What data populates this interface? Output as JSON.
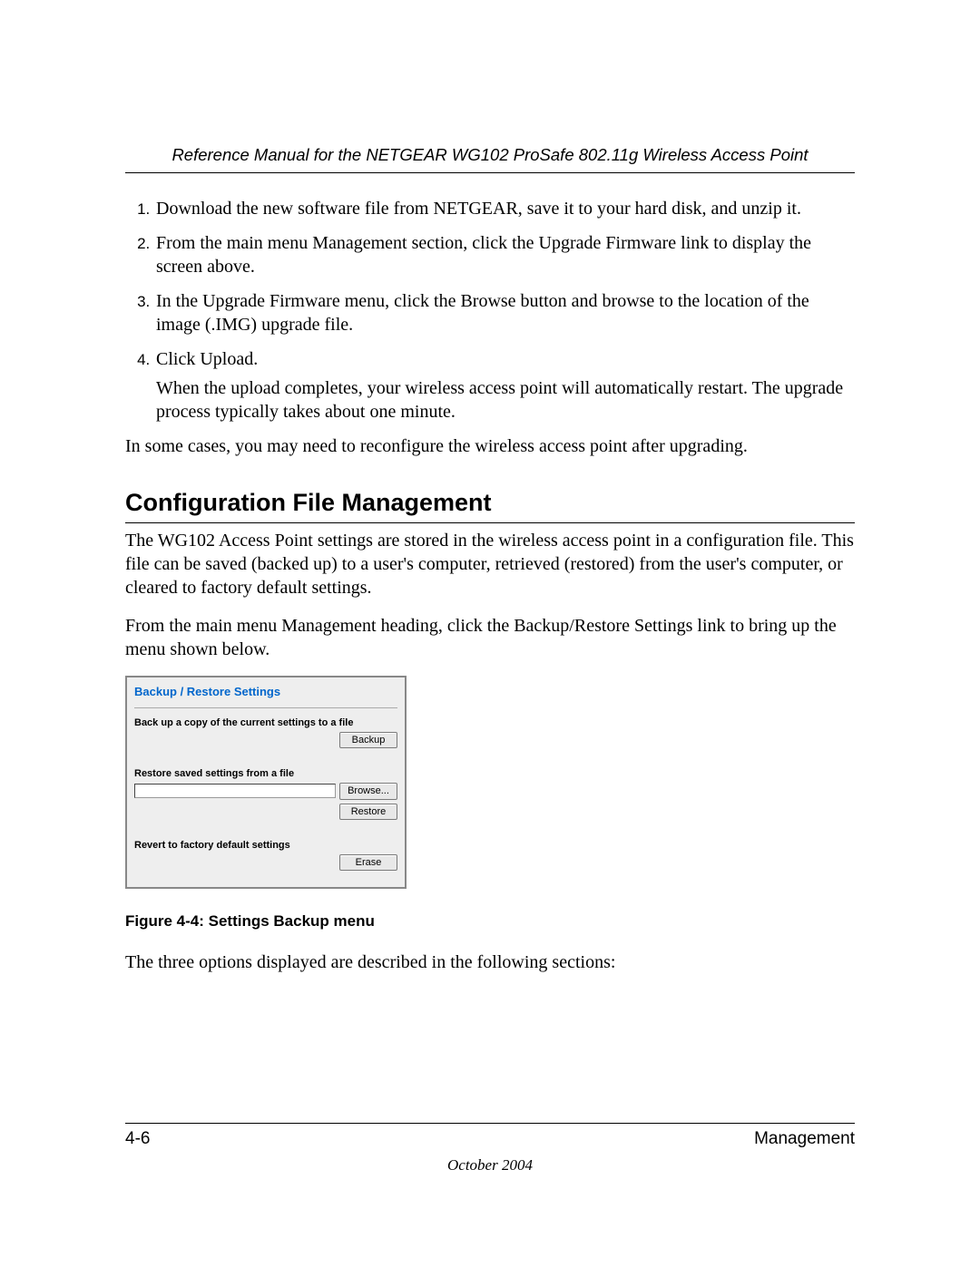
{
  "header": {
    "running_title": "Reference Manual for the NETGEAR WG102 ProSafe 802.11g Wireless Access Point"
  },
  "steps": {
    "s1": "Download the new software file from NETGEAR, save it to your hard disk, and unzip it.",
    "s2": "From the main menu Management section, click the Upgrade Firmware link to display the screen above.",
    "s3": "In the Upgrade Firmware menu, click the Browse button and browse to the location of the image (.IMG) upgrade file.",
    "s4": "Click Upload.",
    "s4b": "When the upload completes, your wireless access point will automatically restart. The upgrade process typically takes about one minute."
  },
  "para_after_steps": "In some cases, you may need to reconfigure the wireless access point after upgrading.",
  "section_heading": "Configuration File Management",
  "para_intro1": "The WG102 Access Point settings are stored in the wireless access point in a configuration file. This file can be saved (backed up) to a user's computer, retrieved (restored) from the user's computer, or cleared to factory default settings.",
  "para_intro2": "From the main menu Management heading, click the Backup/Restore Settings link to bring up the menu shown below.",
  "figure": {
    "panel_title": "Backup / Restore Settings",
    "label_backup": "Back up a copy of the current settings to a file",
    "btn_backup": "Backup",
    "label_restore": "Restore saved settings from a file",
    "btn_browse": "Browse...",
    "btn_restore": "Restore",
    "label_revert": "Revert to factory default settings",
    "btn_erase": "Erase",
    "caption": "Figure 4-4:  Settings Backup menu"
  },
  "para_after_figure": "The three options displayed are described in the following sections:",
  "footer": {
    "page_num": "4-6",
    "section": "Management",
    "date": "October 2004"
  }
}
